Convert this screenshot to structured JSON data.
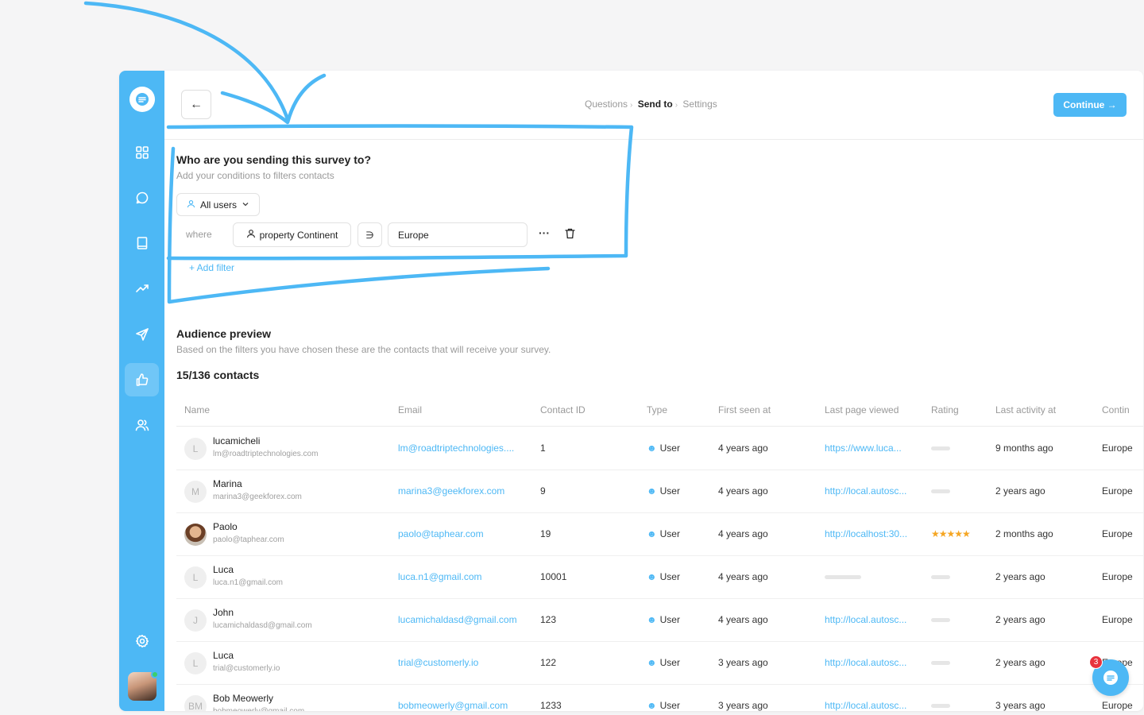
{
  "sidebar": {
    "logo_icon": "chat-bubble-logo-icon",
    "items": [
      {
        "name": "dashboard",
        "icon": "grid-icon",
        "active": false
      },
      {
        "name": "conversations",
        "icon": "chat-icon",
        "active": false
      },
      {
        "name": "knowledge-base",
        "icon": "book-icon",
        "active": false
      },
      {
        "name": "analytics",
        "icon": "trend-icon",
        "active": false
      },
      {
        "name": "campaigns",
        "icon": "send-icon",
        "active": false
      },
      {
        "name": "surveys",
        "icon": "thumbs-up-icon",
        "active": true
      },
      {
        "name": "contacts",
        "icon": "users-icon",
        "active": false
      }
    ],
    "settings_icon": "gear-icon"
  },
  "header": {
    "back_label": "←",
    "steps": [
      "Questions",
      "Send to",
      "Settings"
    ],
    "current_step": "Send to",
    "continue_label": "Continue →"
  },
  "filter_section": {
    "title": "Who are you sending this survey to?",
    "subtitle": "Add your conditions to filters contacts",
    "audience_select": "All users",
    "where_label": "where",
    "property": "property Continent",
    "operator": "∋",
    "value": "Europe",
    "more_label": "···",
    "add_filter_label": "+ Add filter"
  },
  "preview": {
    "title": "Audience preview",
    "subtitle": "Based on the filters you have chosen these are the contacts that will receive your survey.",
    "count": "15/136 contacts"
  },
  "table": {
    "columns": [
      "Name",
      "Email",
      "Contact ID",
      "Type",
      "First seen at",
      "Last page viewed",
      "Rating",
      "Last activity at",
      "Contin"
    ],
    "rows": [
      {
        "initial": "L",
        "name": "lucamicheli",
        "sub_email": "lm@roadtriptechnologies.com",
        "email": "lm@roadtriptechnologies....",
        "id": "1",
        "type": "User",
        "first_seen": "4 years ago",
        "last_page": "https://www.luca...",
        "rating": "",
        "last_activity": "9 months ago",
        "continent": "Europe"
      },
      {
        "initial": "M",
        "name": "Marina",
        "sub_email": "marina3@geekforex.com",
        "email": "marina3@geekforex.com",
        "id": "9",
        "type": "User",
        "first_seen": "4 years ago",
        "last_page": "http://local.autosc...",
        "rating": "",
        "last_activity": "2 years ago",
        "continent": "Europe"
      },
      {
        "initial": "",
        "photo": true,
        "name": "Paolo",
        "sub_email": "paolo@taphear.com",
        "email": "paolo@taphear.com",
        "id": "19",
        "type": "User",
        "first_seen": "4 years ago",
        "last_page": "http://localhost:30...",
        "rating": "★★★★★",
        "last_activity": "2 months ago",
        "continent": "Europe"
      },
      {
        "initial": "L",
        "name": "Luca",
        "sub_email": "luca.n1@gmail.com",
        "email": "luca.n1@gmail.com",
        "id": "10001",
        "type": "User",
        "first_seen": "4 years ago",
        "last_page": "",
        "rating": "",
        "last_activity": "2 years ago",
        "continent": "Europe"
      },
      {
        "initial": "J",
        "name": "John",
        "sub_email": "lucamichaldasd@gmail.com",
        "email": "lucamichaldasd@gmail.com",
        "id": "123",
        "type": "User",
        "first_seen": "4 years ago",
        "last_page": "http://local.autosc...",
        "rating": "",
        "last_activity": "2 years ago",
        "continent": "Europe"
      },
      {
        "initial": "L",
        "name": "Luca",
        "sub_email": "trial@customerly.io",
        "email": "trial@customerly.io",
        "id": "122",
        "type": "User",
        "first_seen": "3 years ago",
        "last_page": "http://local.autosc...",
        "rating": "",
        "last_activity": "2 years ago",
        "continent": "Europe"
      },
      {
        "initial": "BM",
        "name": "Bob Meowerly",
        "sub_email": "bobmeowerly@gmail.com",
        "email": "bobmeowerly@gmail.com",
        "id": "1233",
        "type": "User",
        "first_seen": "3 years ago",
        "last_page": "http://local.autosc...",
        "rating": "",
        "last_activity": "3 years ago",
        "continent": "Europe"
      }
    ]
  },
  "chat_widget": {
    "badge": "3",
    "icon": "chat-launcher-icon"
  },
  "colors": {
    "accent": "#4db8f5",
    "star": "#f5a623",
    "badge": "#e8323c"
  }
}
